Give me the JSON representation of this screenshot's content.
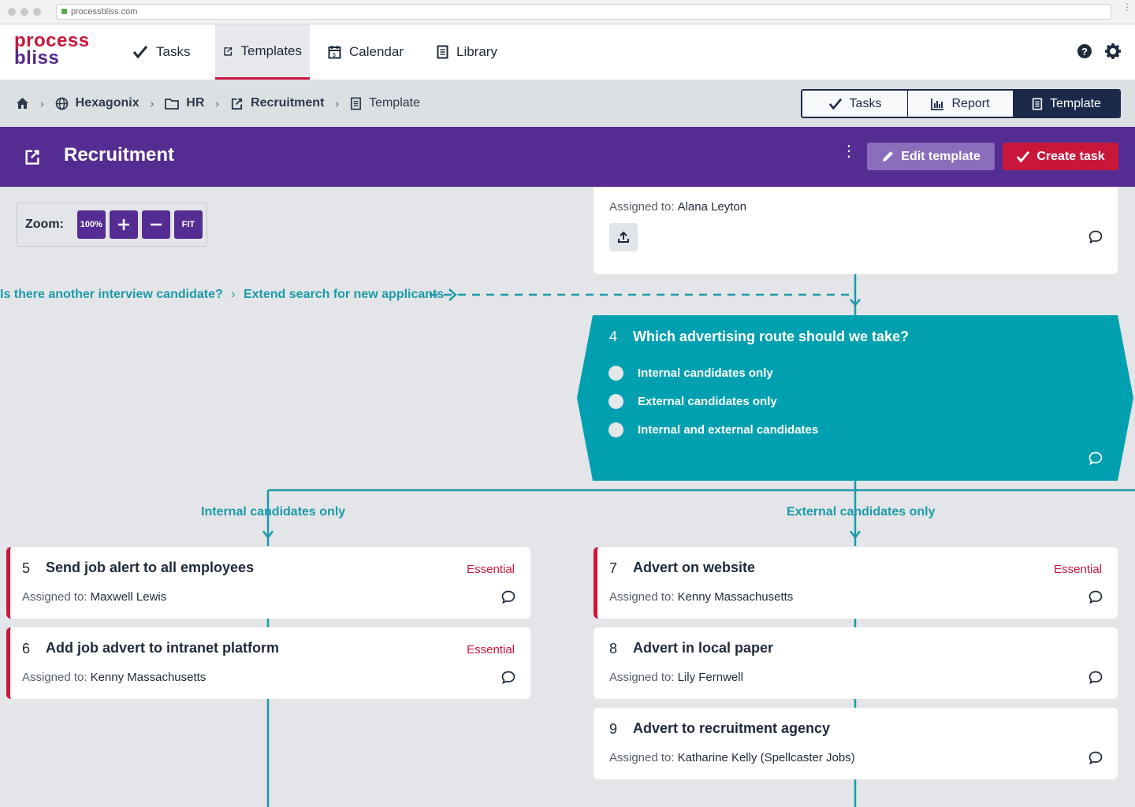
{
  "browser": {
    "url": "processbliss.com"
  },
  "brand": {
    "line1": "process",
    "line2": "bliss",
    "accent": "#c8173a",
    "primary": "#552d92",
    "teal": "#00a0b0"
  },
  "nav": {
    "items": [
      {
        "label": "Tasks",
        "icon": "check-icon"
      },
      {
        "label": "Templates",
        "icon": "template-icon",
        "active": true
      },
      {
        "label": "Calendar",
        "icon": "calendar-icon"
      },
      {
        "label": "Library",
        "icon": "document-icon"
      }
    ]
  },
  "breadcrumb": {
    "items": [
      {
        "label": "Hexagonix",
        "icon": "globe-icon"
      },
      {
        "label": "HR",
        "icon": "folder-icon"
      },
      {
        "label": "Recruitment",
        "icon": "template-icon"
      },
      {
        "label": "Template",
        "icon": "document-icon"
      }
    ]
  },
  "view_toggle": {
    "tasks": "Tasks",
    "report": "Report",
    "template": "Template",
    "selected": "Template"
  },
  "header": {
    "title": "Recruitment",
    "edit_label": "Edit template",
    "create_label": "Create task"
  },
  "zoom": {
    "label": "Zoom:",
    "level": "100%",
    "fit": "FIT"
  },
  "assigned_prefix": "Assigned to:",
  "top_card": {
    "assignee": "Alana Leyton"
  },
  "loop_link": {
    "question": "Is there another interview candidate?",
    "target": "Extend search for new applicants"
  },
  "decision": {
    "number": "4",
    "title": "Which advertising route should we take?",
    "options": [
      "Internal candidates only",
      "External candidates only",
      "Internal and external candidates"
    ]
  },
  "branches": {
    "left": "Internal candidates only",
    "right": "External candidates only"
  },
  "essential_label": "Essential",
  "cards": [
    {
      "number": "5",
      "title": "Send job alert to all employees",
      "assignee": "Maxwell Lewis",
      "essential": true
    },
    {
      "number": "6",
      "title": "Add job advert to intranet platform",
      "assignee": "Kenny Massachusetts",
      "essential": true
    },
    {
      "number": "7",
      "title": "Advert on website",
      "assignee": "Kenny Massachusetts",
      "essential": true
    },
    {
      "number": "8",
      "title": "Advert in local paper",
      "assignee": "Lily Fernwell",
      "essential": false
    },
    {
      "number": "9",
      "title": "Advert to recruitment agency",
      "assignee": "Katharine Kelly (Spellcaster Jobs)",
      "essential": false
    }
  ]
}
